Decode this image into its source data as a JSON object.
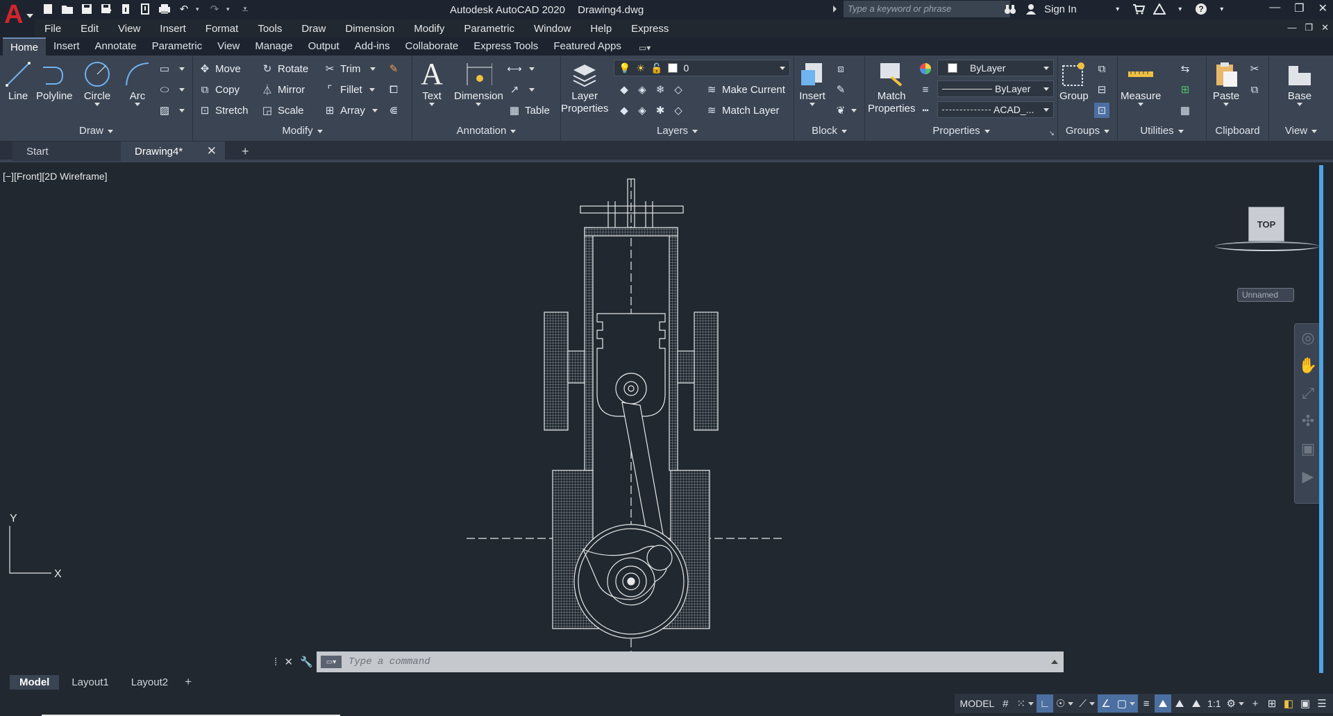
{
  "title_bar": {
    "app_letter": "A",
    "app_name": "Autodesk AutoCAD 2020",
    "file_name": "Drawing4.dwg",
    "search_placeholder": "Type a keyword or phrase",
    "sign_in": "Sign In",
    "quick_access_icons": [
      "new-icon",
      "open-icon",
      "save-icon",
      "save-as-icon",
      "open-web-icon",
      "save-web-icon",
      "plot-icon",
      "undo-icon",
      "redo-icon",
      "customize-icon"
    ]
  },
  "menu_bar": [
    "File",
    "Edit",
    "View",
    "Insert",
    "Format",
    "Tools",
    "Draw",
    "Dimension",
    "Modify",
    "Parametric",
    "Window",
    "Help",
    "Express"
  ],
  "ribbon_tabs": [
    "Home",
    "Insert",
    "Annotate",
    "Parametric",
    "View",
    "Manage",
    "Output",
    "Add-ins",
    "Collaborate",
    "Express Tools",
    "Featured Apps"
  ],
  "active_ribbon_tab": "Home",
  "ribbon": {
    "draw": {
      "title": "Draw",
      "line": "Line",
      "polyline": "Polyline",
      "circle": "Circle",
      "arc": "Arc"
    },
    "modify": {
      "title": "Modify",
      "move": "Move",
      "rotate": "Rotate",
      "trim": "Trim",
      "copy": "Copy",
      "mirror": "Mirror",
      "fillet": "Fillet",
      "stretch": "Stretch",
      "scale": "Scale",
      "array": "Array"
    },
    "annotation": {
      "title": "Annotation",
      "text": "Text",
      "dimension": "Dimension",
      "table": "Table"
    },
    "layers": {
      "title": "Layers",
      "layer_properties_1": "Layer",
      "layer_properties_2": "Properties",
      "current_layer": "0",
      "make_current": "Make Current",
      "match_layer": "Match Layer"
    },
    "block": {
      "title": "Block",
      "insert": "Insert"
    },
    "properties": {
      "title": "Properties",
      "match_1": "Match",
      "match_2": "Properties",
      "color": "ByLayer",
      "lineweight": "ByLayer",
      "linetype": "ACAD_..."
    },
    "groups": {
      "title": "Groups",
      "group": "Group"
    },
    "utilities": {
      "title": "Utilities",
      "measure": "Measure"
    },
    "clipboard": {
      "title": "Clipboard",
      "paste": "Paste"
    },
    "view": {
      "title": "View",
      "base": "Base"
    }
  },
  "doc_tabs": {
    "start": "Start",
    "active": "Drawing4*"
  },
  "viewport": {
    "label": "[−][Front][2D Wireframe]",
    "viewcube_face": "TOP",
    "wcs": "Unnamed"
  },
  "ucs": {
    "x": "X",
    "y": "Y"
  },
  "command_line": {
    "placeholder": "Type a command"
  },
  "layout_tabs": [
    "Model",
    "Layout1",
    "Layout2"
  ],
  "status_bar": {
    "model": "MODEL",
    "scale": "1:1"
  },
  "colors": {
    "background": "#212830",
    "ribbon": "#3b4453",
    "logo_red": "#d3262a",
    "accent_blue": "#4b6fa0"
  }
}
